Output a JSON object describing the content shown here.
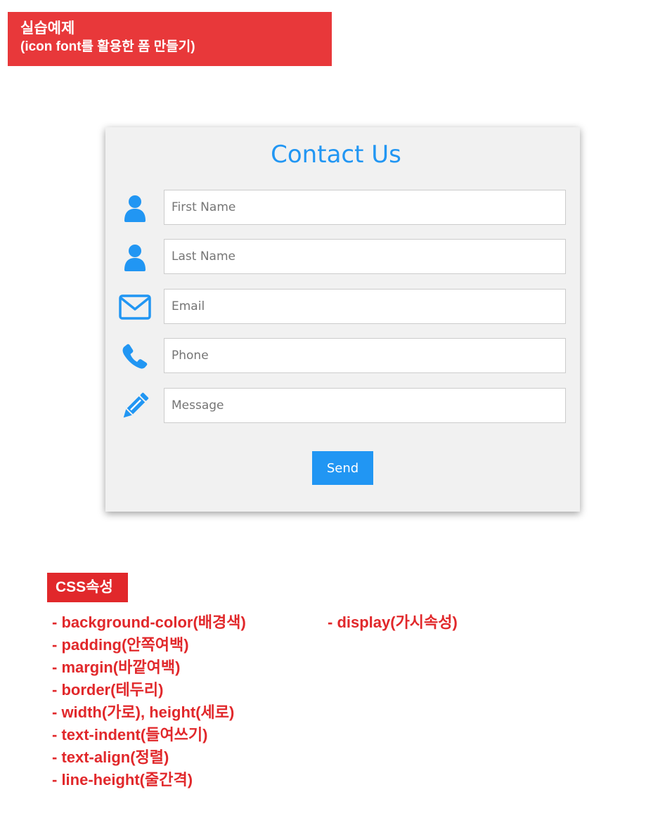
{
  "banner": {
    "title": "실습예제",
    "subtitle": "(icon font를 활용한 폼 만들기)"
  },
  "form": {
    "title": "Contact Us",
    "fields": {
      "first_name": {
        "placeholder": "First Name",
        "icon": "user-icon"
      },
      "last_name": {
        "placeholder": "Last Name",
        "icon": "user-icon"
      },
      "email": {
        "placeholder": "Email",
        "icon": "envelope-icon"
      },
      "phone": {
        "placeholder": "Phone",
        "icon": "phone-icon"
      },
      "message": {
        "placeholder": "Message",
        "icon": "pencil-icon"
      }
    },
    "send_label": "Send"
  },
  "css_section": {
    "badge": "CSS속성",
    "col1": [
      "- background-color(배경색)",
      "- padding(안쪽여백)",
      "- margin(바깥여백)",
      "- border(테두리)",
      "- width(가로), height(세로)",
      "- text-indent(들여쓰기)",
      "- text-align(정렬)",
      "- line-height(줄간격)"
    ],
    "col2": [
      "- display(가시속성)"
    ]
  },
  "colors": {
    "accent": "#2196f3",
    "banner_red": "#e8383a",
    "label_red": "#e1282b",
    "card_bg": "#f1f1f1"
  }
}
